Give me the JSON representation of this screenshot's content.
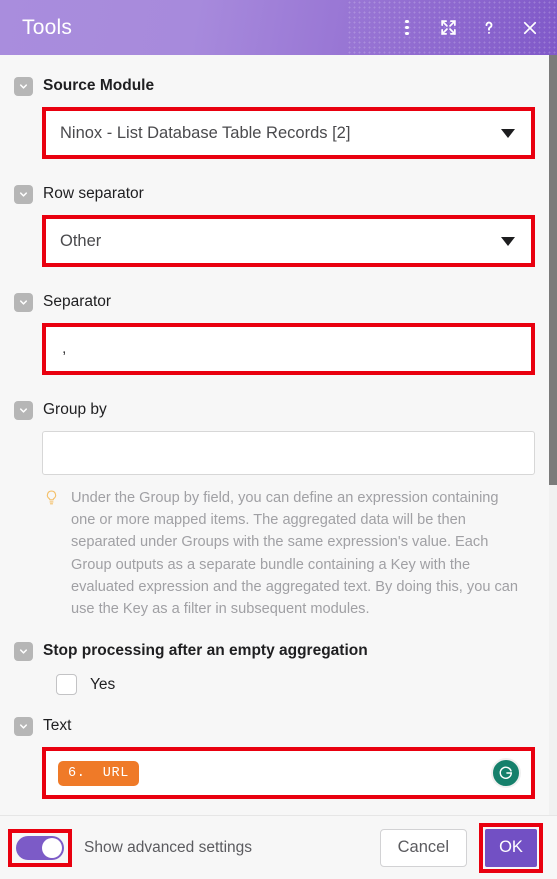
{
  "window": {
    "title": "Tools",
    "actions": [
      {
        "name": "more-options-icon",
        "label": "More options"
      },
      {
        "name": "expand-icon",
        "label": "Expand"
      },
      {
        "name": "help-icon",
        "label": "Help"
      },
      {
        "name": "close-icon",
        "label": "Close"
      }
    ]
  },
  "fields": {
    "source_module": {
      "label": "Source Module",
      "value": "Ninox - List Database Table Records [2]"
    },
    "row_separator": {
      "label": "Row separator",
      "value": "Other"
    },
    "separator": {
      "label": "Separator",
      "value": ","
    },
    "group_by": {
      "label": "Group by",
      "value": "",
      "hint": "Under the Group by field, you can define an expression containing one or more mapped items. The aggregated data will be then separated under Groups with the same expression's value. Each Group outputs as a separate bundle containing a Key with the evaluated expression and the aggregated text. By doing this, you can use the Key as a filter in subsequent modules."
    },
    "stop_processing": {
      "label": "Stop processing after an empty aggregation",
      "checkbox_label": "Yes",
      "checked": false
    },
    "text": {
      "label": "Text",
      "token": "6.  URL",
      "assistant_icon": "grammarly-icon"
    }
  },
  "footer": {
    "advanced_toggle_label": "Show advanced settings",
    "advanced_toggle_on": true,
    "cancel_label": "Cancel",
    "ok_label": "OK"
  },
  "colors": {
    "header_gradient_start": "#a98ddd",
    "header_gradient_end": "#8059c9",
    "highlight_red": "#e9000f",
    "accent_purple": "#7250c4",
    "token_orange": "#ef7a28",
    "grammarly_green": "#15806b"
  }
}
